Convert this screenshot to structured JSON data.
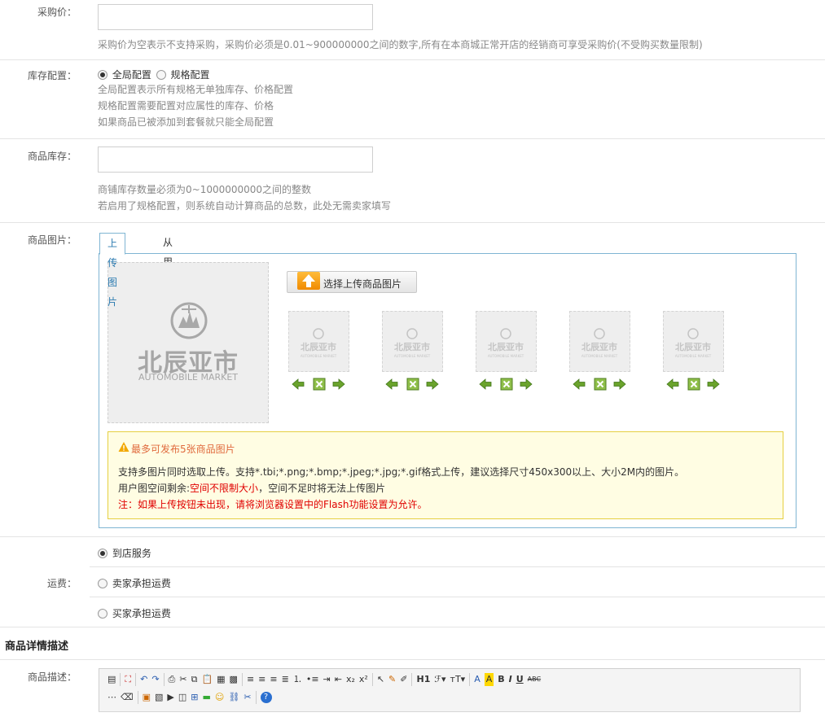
{
  "purchase_price": {
    "label": "采购价：",
    "value": "",
    "hint": "采购价为空表示不支持采购，采购价必须是0.01~900000000之间的数字,所有在本商城正常开店的经销商可享受采购价(不受购买数量限制)"
  },
  "stock_config": {
    "label": "库存配置：",
    "options": [
      "全局配置",
      "规格配置"
    ],
    "selected": "全局配置",
    "hints": [
      "全局配置表示所有规格无单独库存、价格配置",
      "规格配置需要配置对应属性的库存、价格",
      "如果商品已被添加到套餐就只能全局配置"
    ]
  },
  "stock": {
    "label": "商品库存：",
    "value": "",
    "hints": [
      "商铺库存数量必须为0~1000000000之间的整数",
      "若启用了规格配置，则系统自动计算商品的总数，此处无需卖家填写"
    ]
  },
  "images": {
    "label": "商品图片：",
    "tabs": [
      "上传图片",
      "从用户相册选择"
    ],
    "active_tab": "上传图片",
    "upload_button": "选择上传商品图片",
    "placeholder_brand": "北辰亚市",
    "placeholder_sub": "AUTOMOBILE MARKET",
    "thumb_count": 5,
    "warn_title": "最多可发布5张商品图片",
    "warn_line1": "支持多图片同时选取上传。支持*.tbi;*.png;*.bmp;*.jpeg;*.jpg;*.gif格式上传，建议选择尺寸450x300以上、大小2M内的图片。",
    "warn_line2_prefix": "用户图空间剩余:",
    "warn_line2_red": "空间不限制大小",
    "warn_line2_suffix": "，空间不足时将无法上传图片",
    "warn_line3": "注：如果上传按钮未出现，请将浏览器设置中的Flash功能设置为允许。"
  },
  "freight": {
    "label": "运费：",
    "options": [
      "到店服务",
      "卖家承担运费",
      "买家承担运费"
    ],
    "selected": "到店服务"
  },
  "detail_section": {
    "title": "商品详情描述"
  },
  "description": {
    "label": "商品描述：",
    "toolbar_row1": [
      "H1",
      "A",
      "B",
      "I",
      "U",
      "ABC"
    ],
    "colors": {
      "accent_blue": "#7fb5d3",
      "warn_border": "#e6cf41",
      "red": "#e00000"
    }
  }
}
